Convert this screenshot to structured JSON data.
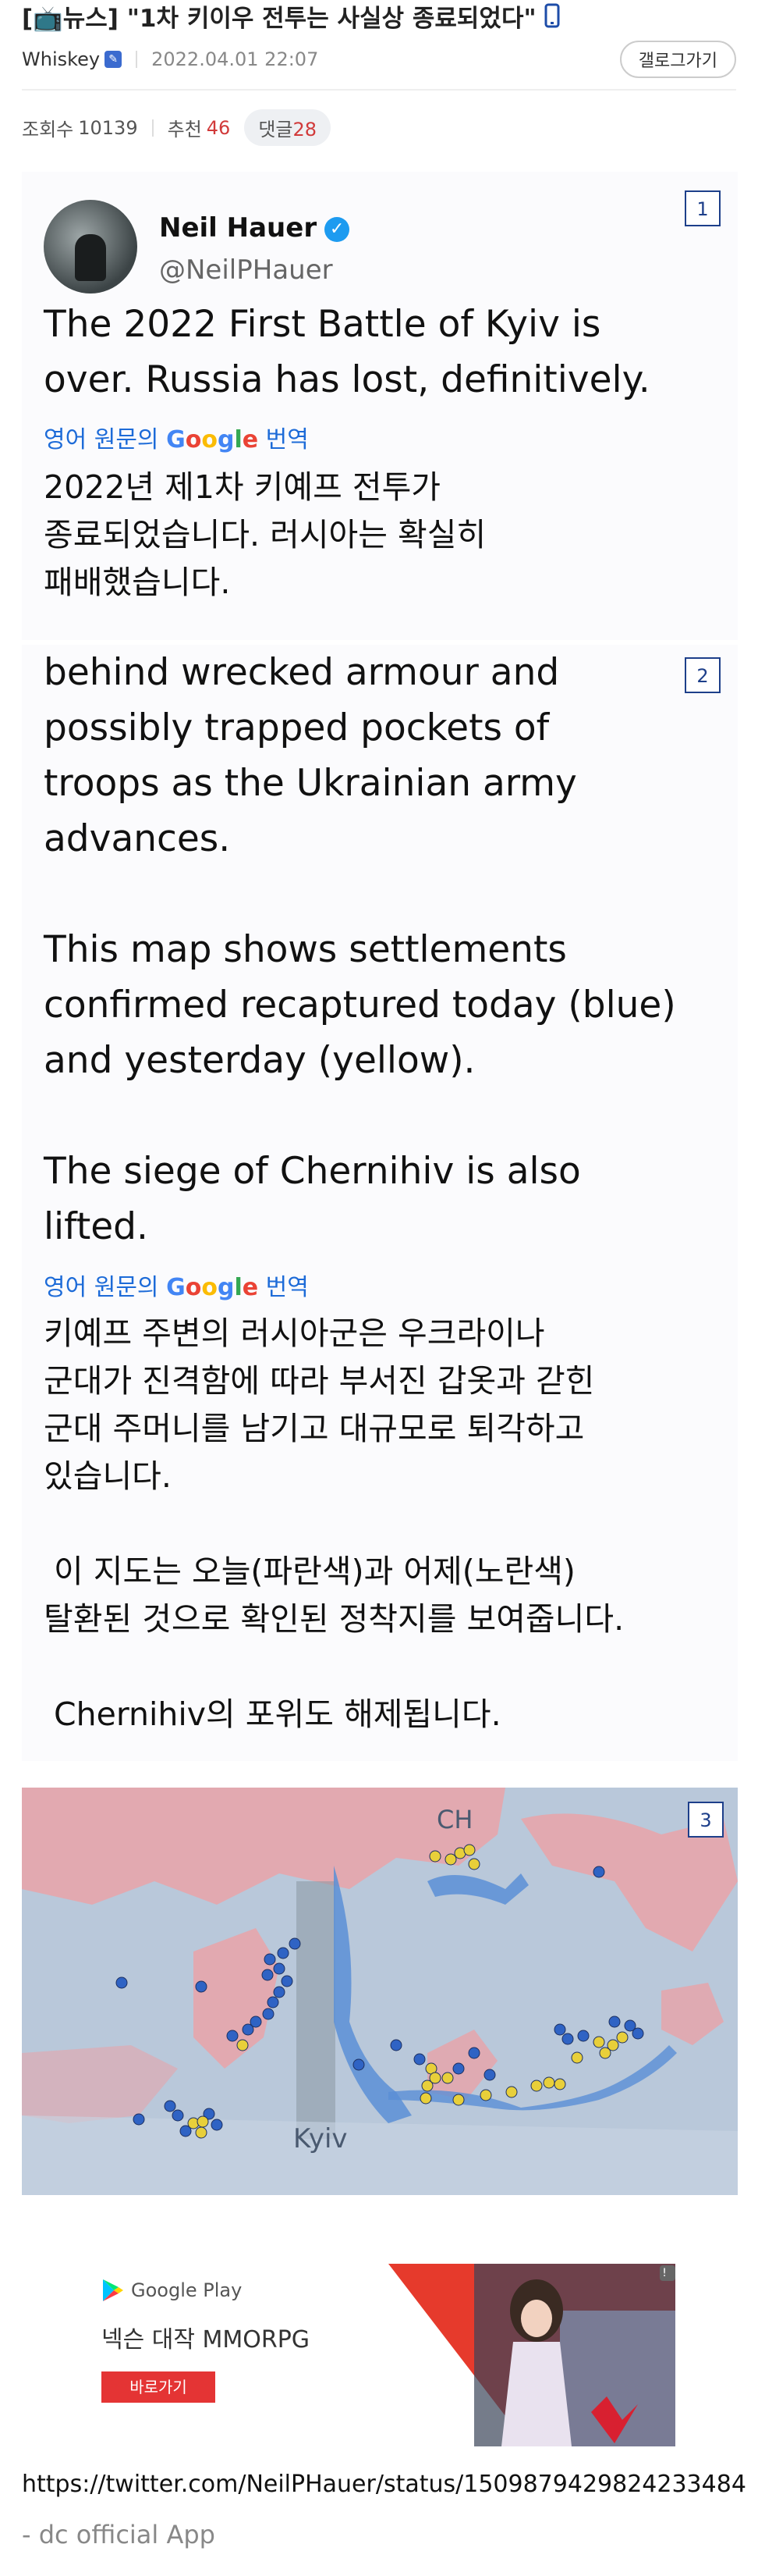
{
  "post": {
    "category": "[📺뉴스]",
    "title": "\"1차 키이우 전투는 사실상 종료되었다\"",
    "author": "Whiskey",
    "date": "2022.04.01 22:07",
    "gallery_button": "갤로그가기"
  },
  "stats": {
    "views_label": "조회수",
    "views": "10139",
    "recommend_label": "추천",
    "recommend": "46",
    "comments_label": "댓글",
    "comments": "28"
  },
  "card1": {
    "index": "1",
    "name": "Neil Hauer",
    "handle": "@NeilPHauer",
    "text_lines": [
      "The 2022 First Battle of Kyiv is",
      "over. Russia has lost, definitively."
    ],
    "translate_prefix": "영어 원문의",
    "translate_brand": "Google",
    "translate_suffix": "번역",
    "ko_lines": [
      "2022년 제1차 키예프 전투가",
      "종료되었습니다. 러시아는 확실히",
      "패배했습니다."
    ]
  },
  "card2": {
    "index": "2",
    "text_lines": [
      "behind wrecked armour and",
      "possibly trapped pockets of",
      "troops as the Ukrainian army",
      "advances.",
      "",
      "This map shows settlements",
      "confirmed recaptured today (blue)",
      "and yesterday (yellow).",
      "",
      "The siege of Chernihiv is also",
      "lifted."
    ],
    "translate_prefix": "영어 원문의",
    "translate_brand": "Google",
    "translate_suffix": "번역",
    "ko_lines": [
      "키예프 주변의 러시아군은 우크라이나",
      "군대가 진격함에 따라 부서진 갑옷과 갇힌",
      "군대 주머니를 남기고 대규모로 퇴각하고",
      "있습니다.",
      "",
      " 이 지도는 오늘(파란색)과 어제(노란색)",
      "탈환된 것으로 확인된 정착지를 보여줍니다.",
      "",
      " Chernihiv의 포위도 해제됩니다."
    ]
  },
  "map": {
    "index": "3",
    "label_ch": "CH",
    "label_kyiv": "Kyiv",
    "colors": {
      "land": "#b9c8da",
      "russian_area": "#e9a3a8",
      "water": "#5a8fd6",
      "blue_dot": "#2f63c4",
      "yellow_dot": "#e8cf3a"
    }
  },
  "ad": {
    "store": "Google Play",
    "headline": "넥슨 대작 MMORPG",
    "cta": "바로가기",
    "info": "!"
  },
  "source_url": "https://twitter.com/NeilPHauer/status/1509879429824233484",
  "footer": "- dc official App"
}
